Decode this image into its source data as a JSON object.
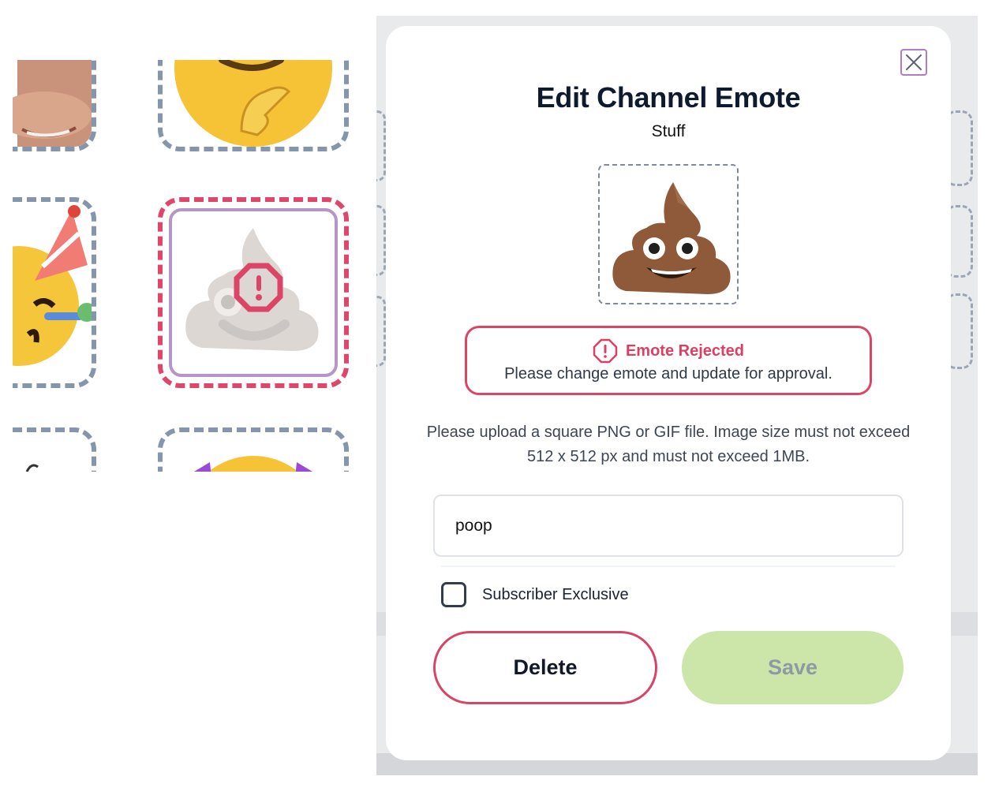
{
  "modal": {
    "title": "Edit Channel Emote",
    "subtitle": "Stuff",
    "preview_icon": "pile-of-poo-emoji",
    "close_icon": "close-icon",
    "alert": {
      "icon": "octagon-alert-icon",
      "title": "Emote Rejected",
      "message": "Please change emote and update for approval."
    },
    "help_text": "Please upload a square PNG or GIF file. Image size must not exceed 512 x 512 px and must not exceed 1MB.",
    "name_input": {
      "value": "poop"
    },
    "subscriber_exclusive": {
      "label": "Subscriber Exclusive",
      "checked": false
    },
    "buttons": {
      "delete": "Delete",
      "save": "Save"
    }
  },
  "grid": {
    "tiles": [
      {
        "icon": "face-photo-thumbnail",
        "status": "normal"
      },
      {
        "icon": "shushing-face-emoji",
        "status": "normal"
      },
      {
        "icon": "partying-face-emoji",
        "status": "normal"
      },
      {
        "icon": "pile-of-poo-emoji",
        "status": "rejected",
        "overlay_icon": "octagon-alert-icon"
      },
      {
        "icon": "emote-thumbnail",
        "status": "normal"
      },
      {
        "icon": "smiling-face-emoji",
        "status": "normal"
      }
    ]
  },
  "colors": {
    "accent_reject": "#dc4566",
    "save_disabled": "#cce5a8",
    "close_border": "#b07cc8",
    "tile_border": "#8595ab",
    "title": "#0e1a2e"
  }
}
